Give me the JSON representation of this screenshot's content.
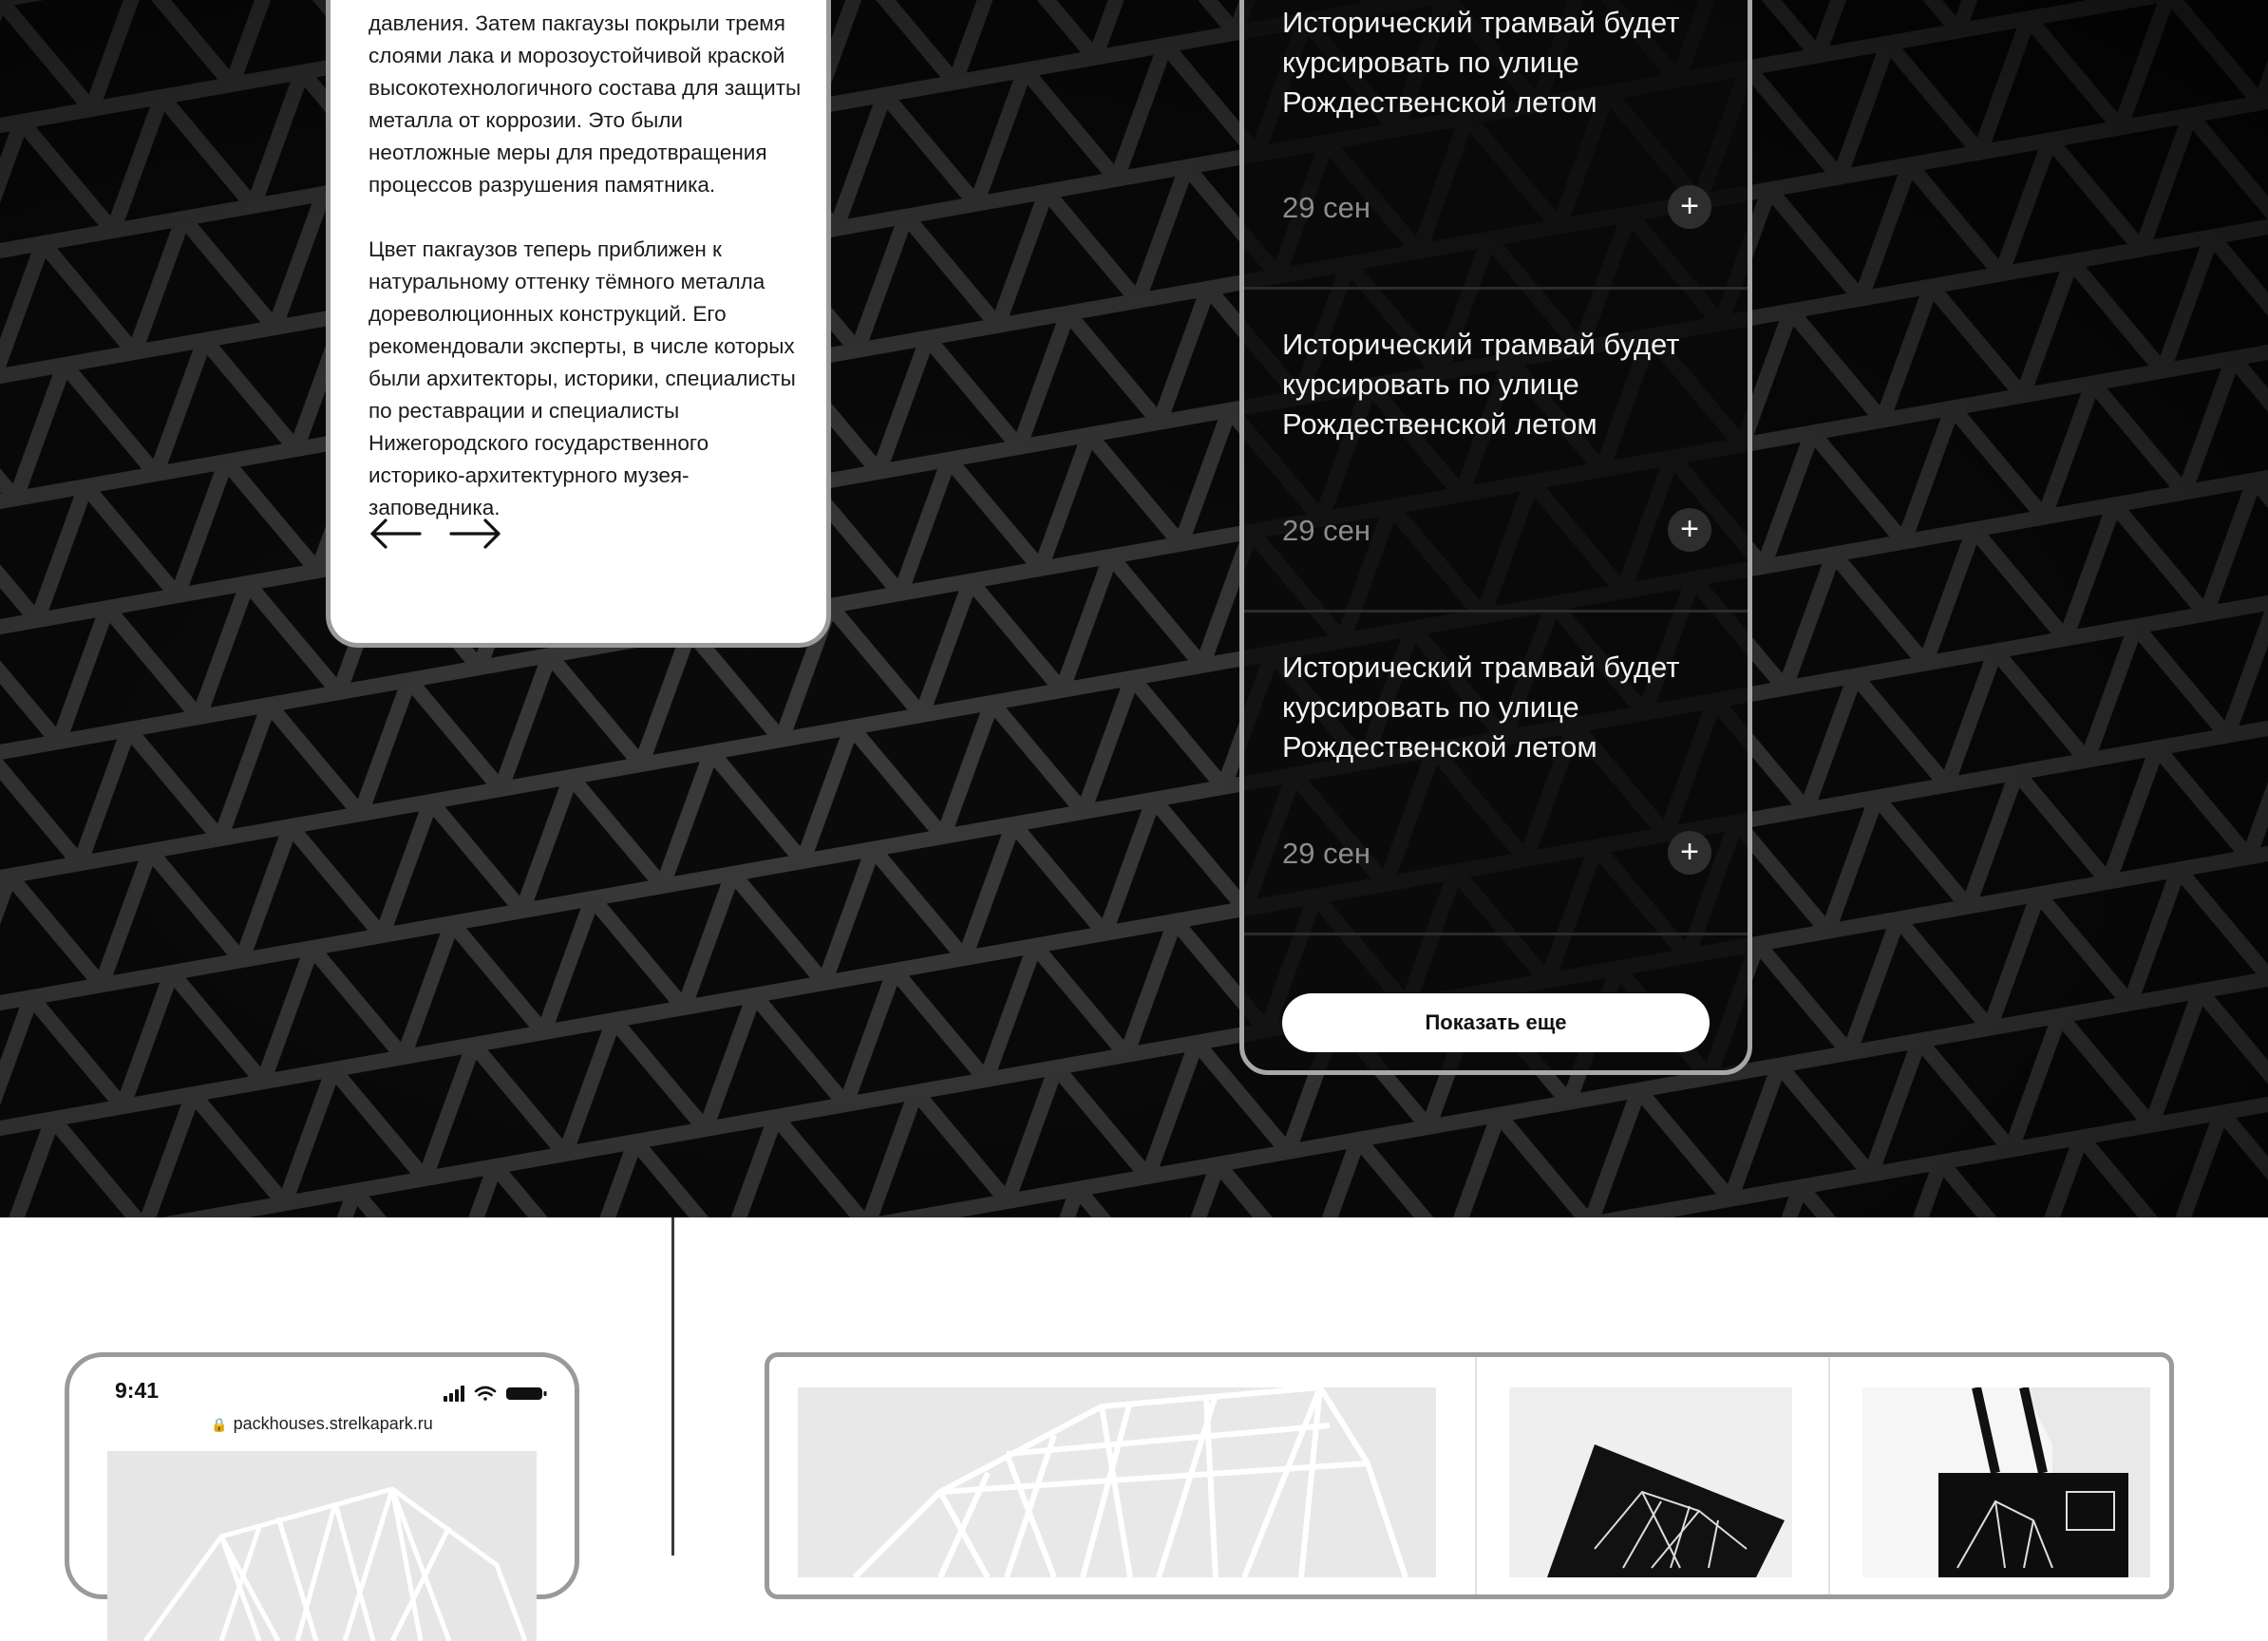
{
  "text_card": {
    "paragraph_1": "давления. Затем пакгаузы покрыли тремя слоями лака и морозоустойчивой краской высокотехнологичного состава для защиты металла от коррозии.  Это были неотложные меры для предотвращения процессов разрушения памятника.",
    "paragraph_2": "Цвет пакгаузов теперь приближен к натуральному оттенку тёмного металла дореволюционных конструкций. Его рекомендовали эксперты, в числе которых были архитекторы, историки, специалисты по реставрации и специалисты Нижегородского государственного историко-архитектурного музея-заповедника.",
    "prev_icon": "arrow-left-icon",
    "next_icon": "arrow-right-icon"
  },
  "news": {
    "items": [
      {
        "title": "Исторический трамвай будет курсировать по улице Рождественской летом",
        "date": "29 сен",
        "action": "+"
      },
      {
        "title": "Исторический трамвай будет курсировать по улице Рождественской летом",
        "date": "29 сен",
        "action": "+"
      },
      {
        "title": "Исторический трамвай будет курсировать по улице Рождественской летом",
        "date": "29 сен",
        "action": "+"
      }
    ],
    "show_more_label": "Показать еще"
  },
  "mobile": {
    "time": "9:41",
    "url": "packhouses.strelkapark.ru",
    "lock_icon": "lock-icon"
  },
  "colors": {
    "hero_bg": "#0b0b0b",
    "card_border": "#9a9a9a",
    "date_text": "#8c8c8c"
  }
}
